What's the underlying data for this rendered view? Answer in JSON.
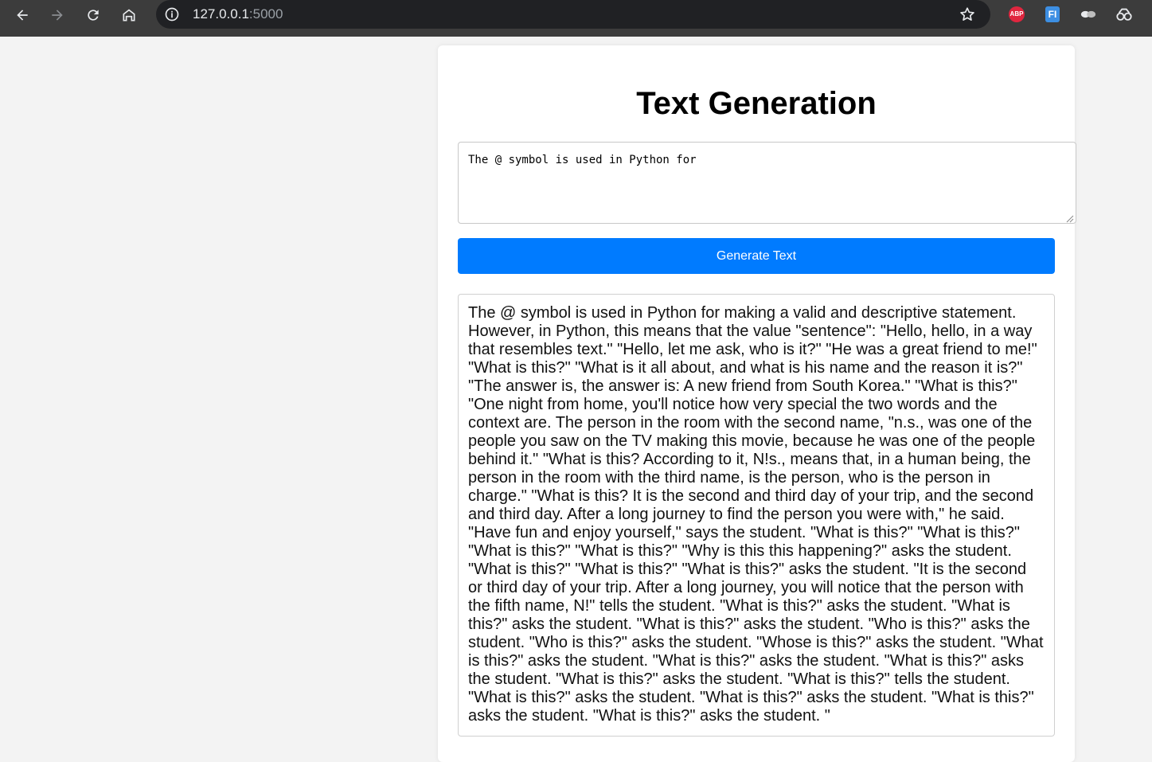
{
  "browser": {
    "url_host": "127.0.0.1",
    "url_port": ":5000",
    "extensions": {
      "abp_label": "ABP",
      "fi_label": "FI"
    }
  },
  "page": {
    "title": "Text Generation",
    "prompt_value": "The @ symbol is used in Python for",
    "generate_label": "Generate Text",
    "output_text": "The @ symbol is used in Python for making a valid and descriptive statement. However, in Python, this means that the value \"sentence\": \"Hello, hello, in a way that resembles text.\" \"Hello, let me ask, who is it?\" \"He was a great friend to me!\" \"What is this?\" \"What is it all about, and what is his name and the reason it is?\" \"The answer is, the answer is: A new friend from South Korea.\" \"What is this?\" \"One night from home, you'll notice how very special the two words and the context are. The person in the room with the second name, \"n.s., was one of the people you saw on the TV making this movie, because he was one of the people behind it.\" \"What is this? According to it, N!s., means that, in a human being, the person in the room with the third name, is the person, who is the person in charge.\" \"What is this? It is the second and third day of your trip, and the second and third day. After a long journey to find the person you were with,\" he said. \"Have fun and enjoy yourself,\" says the student. \"What is this?\" \"What is this?\" \"What is this?\" \"What is this?\" \"Why is this this happening?\" asks the student. \"What is this?\" \"What is this?\" \"What is this?\" asks the student. \"It is the second or third day of your trip. After a long journey, you will notice that the person with the fifth name, N!\" tells the student. \"What is this?\" asks the student. \"What is this?\" asks the student. \"What is this?\" asks the student. \"Who is this?\" asks the student. \"Who is this?\" asks the student. \"Whose is this?\" asks the student. \"What is this?\" asks the student. \"What is this?\" asks the student. \"What is this?\" asks the student. \"What is this?\" asks the student. \"What is this?\" tells the student. \"What is this?\" asks the student. \"What is this?\" asks the student. \"What is this?\" asks the student. \"What is this?\" asks the student. \""
  },
  "colors": {
    "primary_button": "#007bff",
    "toolbar_bg": "#3c3c3c",
    "page_bg": "#f3f3f3"
  }
}
